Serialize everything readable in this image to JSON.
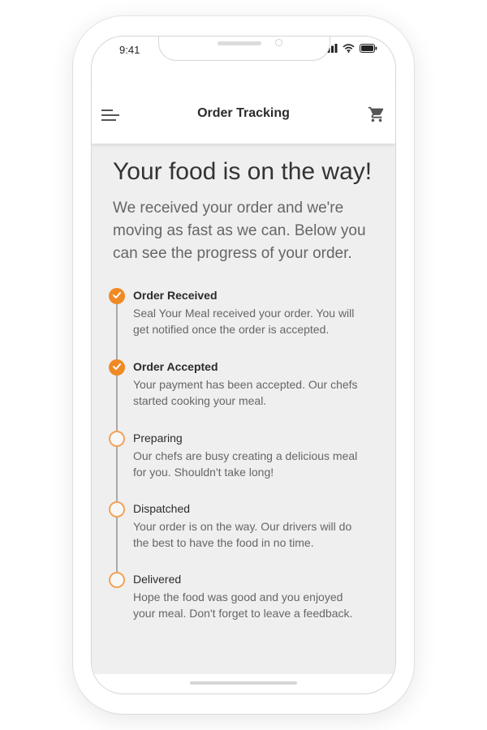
{
  "status_bar": {
    "time": "9:41",
    "icons": [
      "signal-icon",
      "wifi-icon",
      "battery-icon"
    ]
  },
  "appbar": {
    "title": "Order Tracking",
    "menu_icon": "hamburger-menu-icon",
    "cart_icon": "shopping-cart-icon"
  },
  "main": {
    "headline": "Your food is on the way!",
    "intro": "We received your order and we're moving as fast as we can. Below you can see the progress of your order."
  },
  "steps": [
    {
      "title": "Order Received",
      "description": "Seal Your Meal received your order. You will get notified once the order is accepted.",
      "completed": true
    },
    {
      "title": "Order Accepted",
      "description": "Your payment has been accepted. Our chefs started cooking your meal.",
      "completed": true
    },
    {
      "title": "Preparing",
      "description": "Our chefs are busy creating a delicious meal for you. Shouldn't take long!",
      "completed": false
    },
    {
      "title": "Dispatched",
      "description": "Your order is on the way. Our drivers will do the best to have the food in no time.",
      "completed": false
    },
    {
      "title": "Delivered",
      "description": "Hope the food was good and you enjoyed your meal. Don't forget to leave a feedback.",
      "completed": false
    }
  ],
  "colors": {
    "accent": "#f08a24",
    "accent_outline": "#f2a35a",
    "content_background": "#efefef",
    "timeline_line": "#a9a9a9"
  }
}
